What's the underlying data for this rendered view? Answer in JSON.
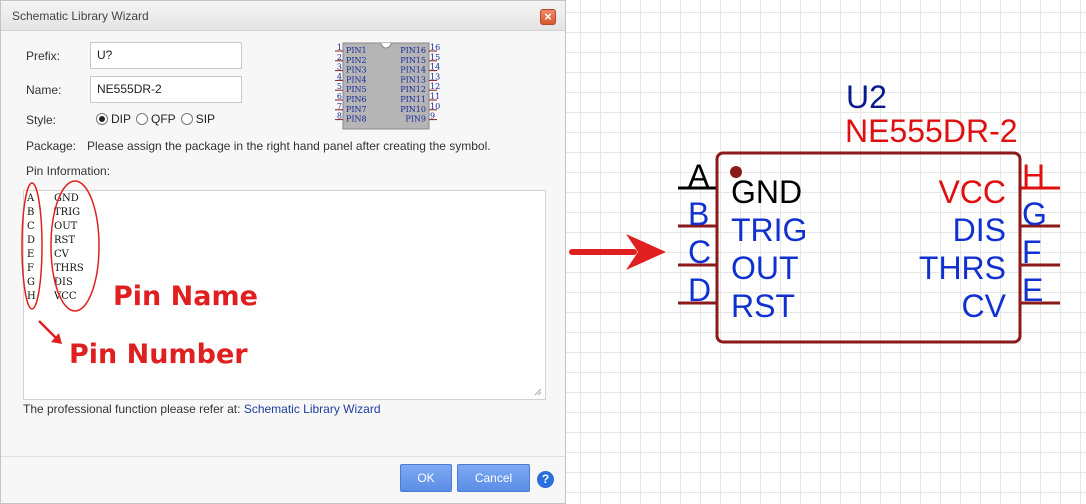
{
  "dialog": {
    "title": "Schematic Library Wizard",
    "close_glyph": "×",
    "prefix_label": "Prefix:",
    "prefix_value": "U?",
    "name_label": "Name:",
    "name_value": "NE555DR-2",
    "style_label": "Style:",
    "style_options": [
      "DIP",
      "QFP",
      "SIP"
    ],
    "style_selected": "DIP",
    "package_label": "Package:",
    "package_text": "Please assign the package in the right hand panel after creating the symbol.",
    "pin_info_label": "Pin Information:",
    "pins": [
      {
        "number": "A",
        "name": "GND"
      },
      {
        "number": "B",
        "name": "TRIG"
      },
      {
        "number": "C",
        "name": "OUT"
      },
      {
        "number": "D",
        "name": "RST"
      },
      {
        "number": "E",
        "name": "CV"
      },
      {
        "number": "F",
        "name": "THRS"
      },
      {
        "number": "G",
        "name": "DIS"
      },
      {
        "number": "H",
        "name": "VCC"
      }
    ],
    "footer_text": "The professional function please refer at:",
    "footer_link": "Schematic Library Wizard",
    "ok_label": "OK",
    "cancel_label": "Cancel",
    "help_glyph": "?"
  },
  "preview": {
    "left_pins": [
      {
        "num": "1",
        "name": "PIN1"
      },
      {
        "num": "2",
        "name": "PIN2"
      },
      {
        "num": "3",
        "name": "PIN3"
      },
      {
        "num": "4",
        "name": "PIN4"
      },
      {
        "num": "5",
        "name": "PIN5"
      },
      {
        "num": "6",
        "name": "PIN6"
      },
      {
        "num": "7",
        "name": "PIN7"
      },
      {
        "num": "8",
        "name": "PIN8"
      }
    ],
    "right_pins": [
      {
        "num": "16",
        "name": "PIN16"
      },
      {
        "num": "15",
        "name": "PIN15"
      },
      {
        "num": "14",
        "name": "PIN14"
      },
      {
        "num": "13",
        "name": "PIN13"
      },
      {
        "num": "12",
        "name": "PIN12"
      },
      {
        "num": "11",
        "name": "PIN11"
      },
      {
        "num": "10",
        "name": "PIN10"
      },
      {
        "num": "9",
        "name": "PIN9"
      }
    ]
  },
  "annotations": {
    "pin_name": "Pin Name",
    "pin_number": "Pin Number"
  },
  "symbol": {
    "prefix": "U2",
    "name": "NE555DR-2",
    "left_pins": [
      {
        "num": "A",
        "name": "GND"
      },
      {
        "num": "B",
        "name": "TRIG"
      },
      {
        "num": "C",
        "name": "OUT"
      },
      {
        "num": "D",
        "name": "RST"
      }
    ],
    "right_pins": [
      {
        "num": "H",
        "name": "VCC"
      },
      {
        "num": "G",
        "name": "DIS"
      },
      {
        "num": "F",
        "name": "THRS"
      },
      {
        "num": "E",
        "name": "CV"
      }
    ],
    "colors": {
      "prefix": "#0a1a8c",
      "name": "#e01010",
      "body": "#8b1a1a",
      "pin_blue": "#1030d0",
      "pin_red": "#e01010",
      "pin_black": "#000000",
      "annotation": "#e02020"
    }
  }
}
